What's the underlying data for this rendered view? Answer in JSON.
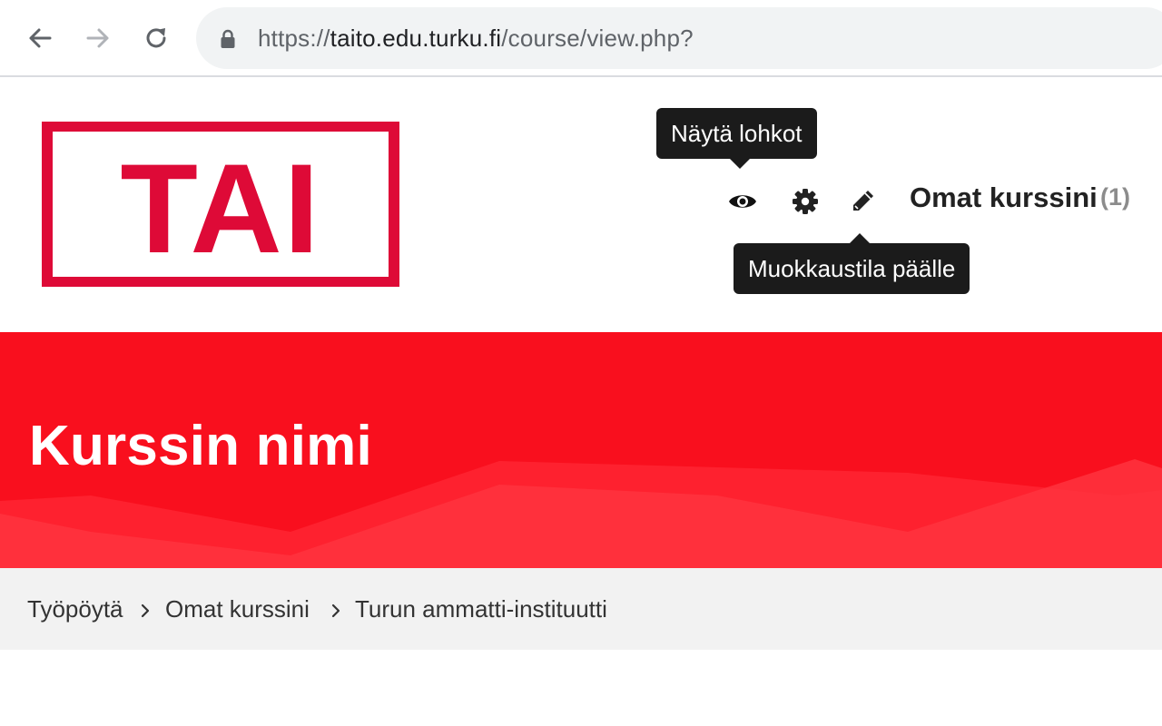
{
  "browser": {
    "url_prefix": "https://",
    "url_host": "taito.edu.turku.fi",
    "url_path": "/course/view.php?"
  },
  "header": {
    "logo_text": "TAI",
    "my_courses_label": "Omat kurssini",
    "my_courses_count": "(1)",
    "tooltip_blocks": "Näytä lohkot",
    "tooltip_edit": "Muokkaustila päälle"
  },
  "banner": {
    "title": "Kurssin nimi"
  },
  "breadcrumb": {
    "items": [
      "Työpöytä",
      "Omat kurssini",
      "Turun ammatti-instituutti"
    ]
  },
  "colors": {
    "brand_red": "#f90f1e",
    "logo_red": "#de0a37",
    "tooltip_bg": "#1b1b1b",
    "breadcrumb_bg": "#f2f2f2"
  },
  "icons": [
    "back-arrow-icon",
    "forward-arrow-icon",
    "reload-icon",
    "lock-icon",
    "eye-icon",
    "gear-icon",
    "pencil-icon",
    "chevron-right-icon"
  ]
}
